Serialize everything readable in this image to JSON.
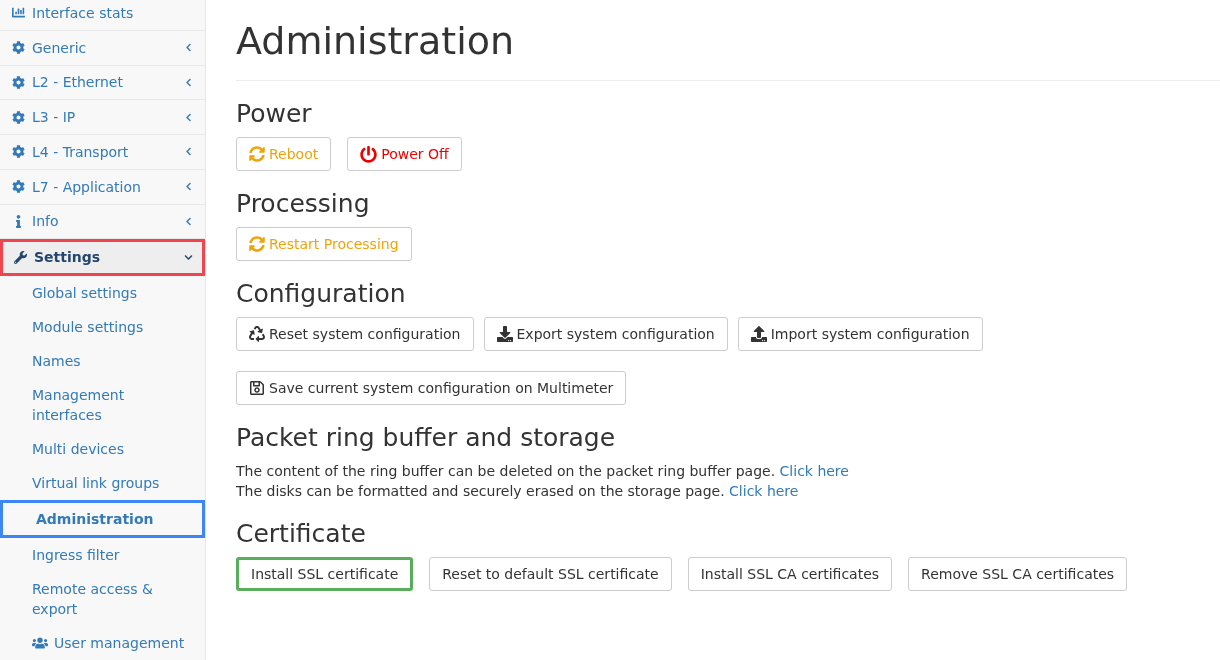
{
  "sidebar": {
    "items": [
      {
        "kind": "link",
        "label": "Interface stats"
      },
      {
        "kind": "menu",
        "label": "Generic",
        "expanded": false
      },
      {
        "kind": "menu",
        "label": "L2 - Ethernet",
        "expanded": false
      },
      {
        "kind": "menu",
        "label": "L3 - IP",
        "expanded": false
      },
      {
        "kind": "menu",
        "label": "L4 - Transport",
        "expanded": false
      },
      {
        "kind": "menu",
        "label": "L7 - Application",
        "expanded": false
      },
      {
        "kind": "menu",
        "label": "Info",
        "expanded": false
      },
      {
        "kind": "menu",
        "label": "Settings",
        "expanded": true,
        "children": [
          {
            "label": "Global settings",
            "selected": false
          },
          {
            "label": "Module settings",
            "selected": false
          },
          {
            "label": "Names",
            "selected": false
          },
          {
            "label": "Management interfaces",
            "selected": false
          },
          {
            "label": "Multi devices",
            "selected": false
          },
          {
            "label": "Virtual link groups",
            "selected": false
          },
          {
            "label": "Administration",
            "selected": true
          },
          {
            "label": "Ingress filter",
            "selected": false
          },
          {
            "label": "Remote access & export",
            "selected": false
          },
          {
            "label": "User management",
            "selected": false
          }
        ]
      }
    ]
  },
  "page": {
    "title": "Administration",
    "sections": [
      {
        "kind": "buttons",
        "heading": "Power",
        "buttons": [
          {
            "label": "Reboot",
            "kind": "reboot"
          },
          {
            "label": "Power Off",
            "kind": "poweroff"
          }
        ]
      },
      {
        "kind": "buttons",
        "heading": "Processing",
        "buttons": [
          {
            "label": "Restart Processing",
            "kind": "reboot"
          }
        ]
      },
      {
        "kind": "buttons",
        "heading": "Configuration",
        "buttons": [
          {
            "label": "Reset system configuration",
            "kind": "reset"
          },
          {
            "label": "Export system configuration",
            "kind": "export"
          },
          {
            "label": "Import system configuration",
            "kind": "import"
          },
          {
            "label": "Save current system configuration on Multimeter",
            "kind": "save"
          }
        ]
      },
      {
        "kind": "text",
        "heading": "Packet ring buffer and storage",
        "lines": [
          {
            "text": "The content of the ring buffer can be deleted on the packet ring buffer page.",
            "link": "Click here"
          },
          {
            "text": "The disks can be formatted and securely erased on the storage page.",
            "link": "Click here"
          }
        ]
      },
      {
        "kind": "buttons",
        "heading": "Certificate",
        "buttons": [
          {
            "label": "Install SSL certificate",
            "kind": "plain",
            "highlighted": true
          },
          {
            "label": "Reset to default SSL certificate",
            "kind": "plain",
            "highlighted": false
          },
          {
            "label": "Install SSL CA certificates",
            "kind": "plain",
            "highlighted": false
          },
          {
            "label": "Remove SSL CA certificates",
            "kind": "plain",
            "highlighted": false
          }
        ]
      }
    ]
  }
}
